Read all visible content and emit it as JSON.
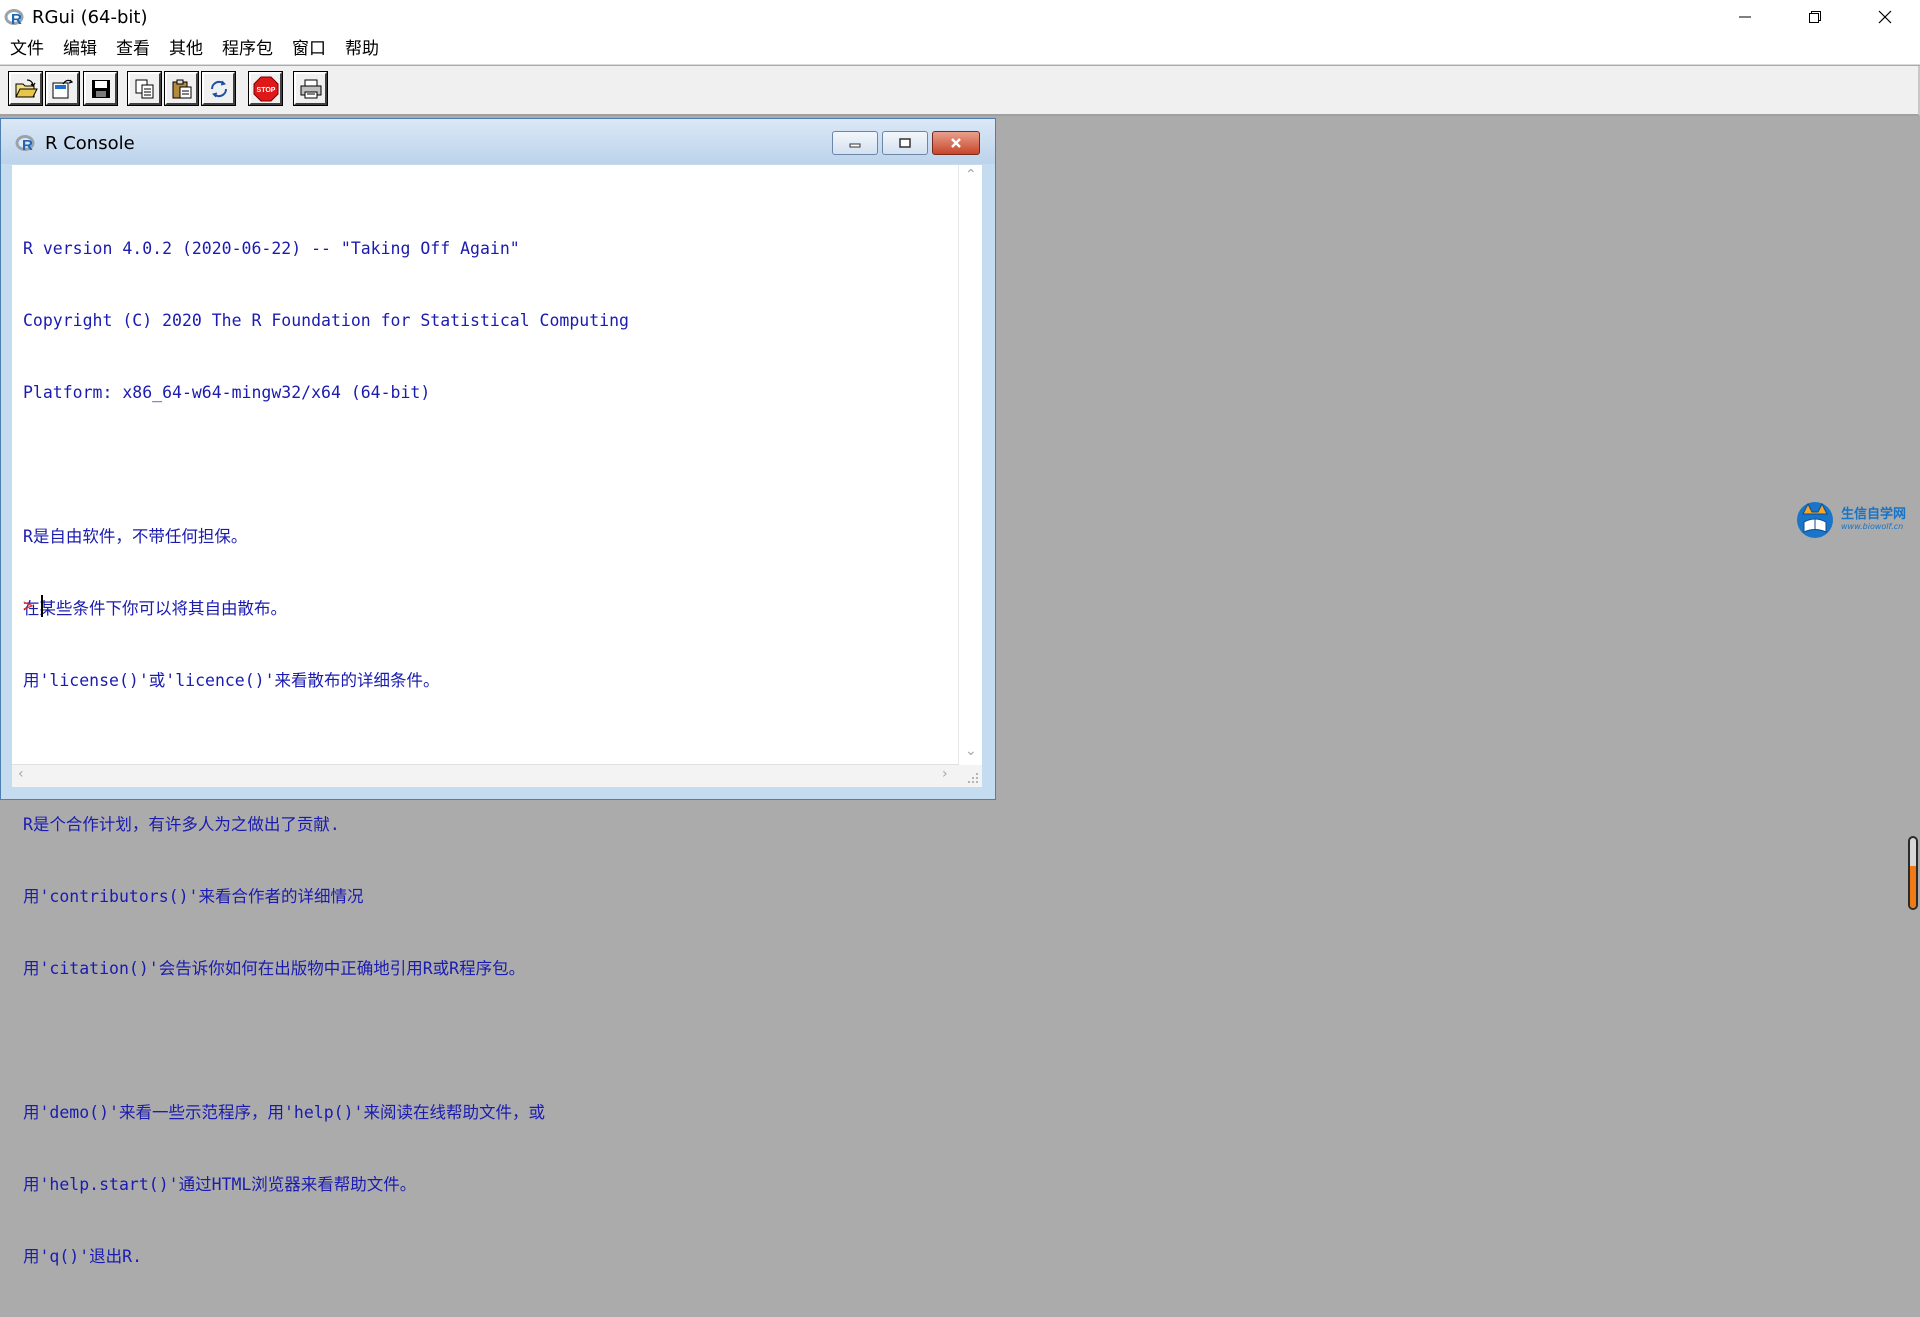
{
  "window": {
    "title": "RGui (64-bit)",
    "controls": [
      "minimize",
      "restore",
      "close"
    ]
  },
  "menu": [
    "文件",
    "编辑",
    "查看",
    "其他",
    "程序包",
    "窗口",
    "帮助"
  ],
  "toolbar": [
    {
      "name": "open-script-icon",
      "tooltip": ""
    },
    {
      "name": "load-workspace-icon",
      "tooltip": ""
    },
    {
      "name": "save-workspace-icon",
      "tooltip": ""
    },
    {
      "name": "copy-icon",
      "tooltip": ""
    },
    {
      "name": "paste-icon",
      "tooltip": ""
    },
    {
      "name": "copy-paste-icon",
      "tooltip": ""
    },
    {
      "name": "stop-icon",
      "label": "STOP"
    },
    {
      "name": "print-icon",
      "tooltip": ""
    }
  ],
  "console_window": {
    "title": "R Console",
    "lines": [
      "R version 4.0.2 (2020-06-22) -- \"Taking Off Again\"",
      "Copyright (C) 2020 The R Foundation for Statistical Computing",
      "Platform: x86_64-w64-mingw32/x64 (64-bit)",
      "",
      "R是自由软件，不带任何担保。",
      "在某些条件下你可以将其自由散布。",
      "用'license()'或'licence()'来看散布的详细条件。",
      "",
      "R是个合作计划，有许多人为之做出了贡献.",
      "用'contributors()'来看合作者的详细情况",
      "用'citation()'会告诉你如何在出版物中正确地引用R或R程序包。",
      "",
      "用'demo()'来看一些示范程序，用'help()'来阅读在线帮助文件，或",
      "用'help.start()'通过HTML浏览器来看帮助文件。",
      "用'q()'退出R."
    ],
    "prompt": ">"
  },
  "watermark": {
    "text": "生信自学网",
    "url": "www.biowolf.cn"
  },
  "edge_slider": {
    "level": 0.6
  },
  "colors": {
    "console_text": "#1b1bb0",
    "prompt": "#e03030",
    "mdi_background": "#ababab"
  }
}
